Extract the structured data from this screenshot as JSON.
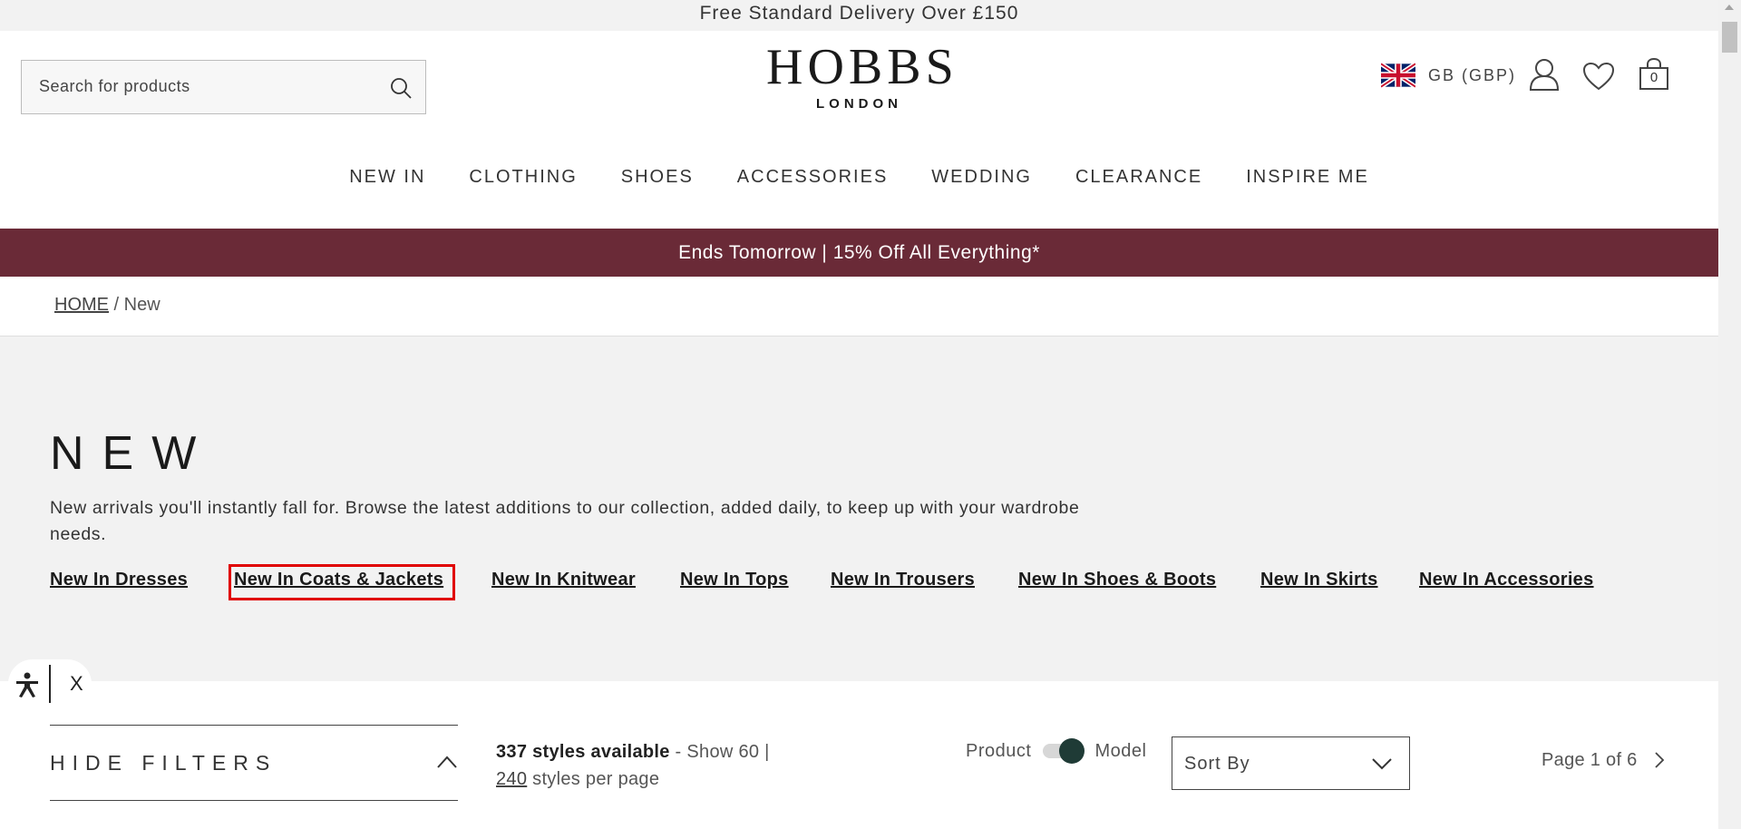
{
  "announcement": "Free Standard Delivery Over £150",
  "header": {
    "search_placeholder": "Search for products",
    "logo_main": "HOBBS",
    "logo_sub": "LONDON",
    "locale": "GB (GBP)",
    "bag_count": "0"
  },
  "nav": [
    "NEW IN",
    "CLOTHING",
    "SHOES",
    "ACCESSORIES",
    "WEDDING",
    "CLEARANCE",
    "INSPIRE ME"
  ],
  "promo": "Ends Tomorrow | 15% Off All Everything*",
  "breadcrumb": {
    "home": "HOME",
    "separator": " / ",
    "current": "New"
  },
  "hero": {
    "title": "NEW",
    "description": "New arrivals you'll instantly fall for. Browse the latest additions to our collection, added daily, to keep up with your wardrobe needs.",
    "categories": [
      "New In Dresses",
      "New In Coats & Jackets",
      "New In Knitwear",
      "New In Tops",
      "New In Trousers",
      "New In Shoes & Boots",
      "New In Skirts",
      "New In Accessories"
    ],
    "highlighted_category": "New In Coats & Jackets"
  },
  "accessibility": {
    "close": "X"
  },
  "listing": {
    "filters_label": "HIDE FILTERS",
    "count_strong": "337 styles available",
    "count_rest": " - Show 60 |",
    "per_page_option": "240",
    "per_page_suffix": " styles per page",
    "toggle_left": "Product",
    "toggle_right": "Model",
    "toggle_state": "Model",
    "sort_label": "Sort By",
    "pager": "Page 1 of 6"
  },
  "colors": {
    "promo": "#6a2a37",
    "highlight": "#e00000",
    "toggle_knob": "#1f3b36"
  }
}
